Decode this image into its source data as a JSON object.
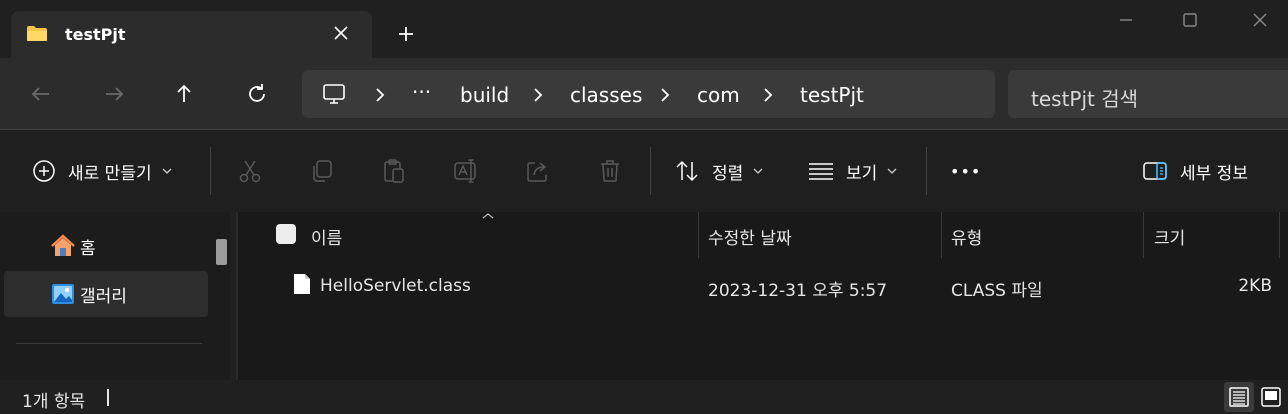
{
  "tab": {
    "title": "testPjt",
    "close_icon": "close-icon",
    "new_tab_icon": "plus-icon"
  },
  "window": {
    "minimize_icon": "minimize-icon",
    "maximize_icon": "maximize-icon",
    "close_icon": "close-icon"
  },
  "nav": {
    "back_icon": "arrow-left-icon",
    "forward_icon": "arrow-right-icon",
    "up_icon": "arrow-up-icon",
    "refresh_icon": "refresh-icon"
  },
  "address": {
    "root_icon": "monitor-icon",
    "ellipsis": "···",
    "segments": [
      "build",
      "classes",
      "com",
      "testPjt"
    ]
  },
  "search": {
    "placeholder": "testPjt 검색"
  },
  "commands": {
    "new_label": "새로 만들기",
    "sort_label": "정렬",
    "view_label": "보기",
    "more_label": "•••",
    "details_label": "세부 정보"
  },
  "sidebar": {
    "items": [
      {
        "label": "홈",
        "icon": "home-icon"
      },
      {
        "label": "갤러리",
        "icon": "gallery-icon"
      }
    ]
  },
  "list": {
    "columns": [
      "이름",
      "수정한 날짜",
      "유형",
      "크기"
    ],
    "rows": [
      {
        "name": "HelloServlet.class",
        "modified": "2023-12-31 오후 5:57",
        "type": "CLASS 파일",
        "size": "2KB"
      }
    ]
  },
  "status": {
    "count_text": "1개 항목",
    "details_view_icon": "details-view-icon",
    "tiles_view_icon": "tiles-view-icon"
  },
  "colors": {
    "accent": "#4cc2ff",
    "folder": "#f5c648",
    "background": "#202020"
  }
}
